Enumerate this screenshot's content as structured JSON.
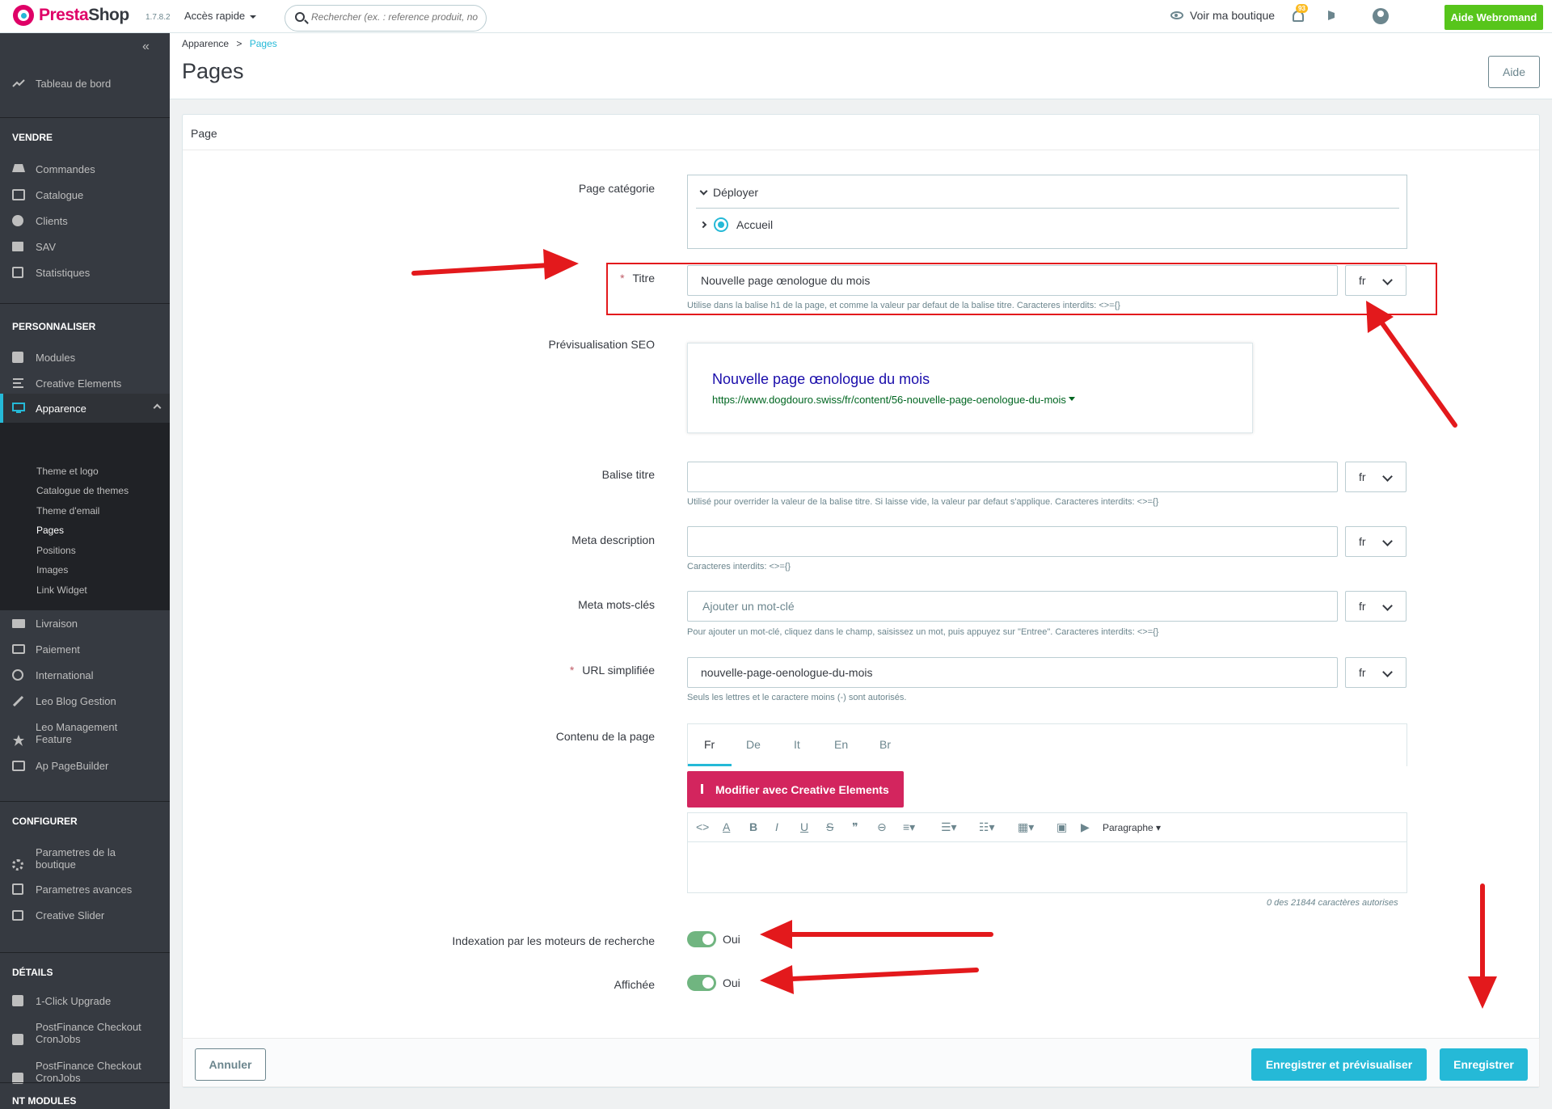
{
  "topbar": {
    "logo_a": "Presta",
    "logo_b": "Shop",
    "version": "1.7.8.2",
    "quick_access": "Accès rapide",
    "search_placeholder": "Rechercher (ex. : reference produit, no",
    "view_shop": "Voir ma boutique",
    "notif_count": "93",
    "help_button": "Aide Webromand"
  },
  "sidebar": {
    "dashboard": "Tableau de bord",
    "sections": {
      "sell": "VENDRE",
      "customize": "PERSONNALISER",
      "configure": "CONFIGURER",
      "details": "DÉTAILS",
      "nt": "NT MODULES"
    },
    "sell_items": [
      "Commandes",
      "Catalogue",
      "Clients",
      "SAV",
      "Statistiques"
    ],
    "customize_items": [
      "Modules",
      "Creative Elements",
      "Apparence"
    ],
    "appearance_sub": [
      "Theme et logo",
      "Catalogue de themes",
      "Theme d'email",
      "Pages",
      "Positions",
      "Images",
      "Link Widget"
    ],
    "more_items": [
      "Livraison",
      "Paiement",
      "International",
      "Leo Blog Gestion",
      "Leo Management",
      "Feature",
      "Ap PageBuilder"
    ],
    "configure_items": [
      "Parametres de la",
      "boutique",
      "Parametres avances",
      "Creative Slider"
    ],
    "details_items": [
      "1-Click Upgrade",
      "PostFinance Checkout",
      "CronJobs",
      "PostFinance Checkout",
      "CronJobs"
    ]
  },
  "header": {
    "crumb_parent": "Apparence",
    "crumb_sep": ">",
    "crumb_current": "Pages",
    "title": "Pages",
    "help": "Aide"
  },
  "form": {
    "panel_title": "Page",
    "category_label": "Page catégorie",
    "deploy": "Déployer",
    "accueil": "Accueil",
    "title_label": "Titre",
    "title_value": "Nouvelle page œnologue du mois",
    "lang": "fr",
    "title_help": "Utilise dans la balise h1 de la page, et comme la valeur par defaut de la balise titre. Caracteres interdits: <>={}",
    "seo_label": "Prévisualisation SEO",
    "seo_title": "Nouvelle page œnologue du mois",
    "seo_url": "https://www.dogdouro.swiss/fr/content/56-nouvelle-page-oenologue-du-mois",
    "meta_title_label": "Balise titre",
    "meta_title_help": "Utilisé pour overrider la valeur de la balise titre. Si laisse vide, la valeur par defaut s'applique. Caracteres interdits: <>={}",
    "meta_desc_label": "Meta description",
    "meta_desc_help": "Caracteres interdits: <>={}",
    "keywords_label": "Meta mots-clés",
    "keywords_placeholder": "Ajouter un mot-clé",
    "keywords_help": "Pour ajouter un mot-clé, cliquez dans le champ, saisissez un mot, puis appuyez sur \"Entree\". Caracteres interdits: <>={}",
    "url_label": "URL simplifiée",
    "url_value": "nouvelle-page-oenologue-du-mois",
    "url_help": "Seuls les lettres et le caractere moins (-) sont autorisés.",
    "content_label": "Contenu de la page",
    "tabs": [
      "Fr",
      "De",
      "It",
      "En",
      "Br"
    ],
    "ce_button": "Modifier avec Creative Elements",
    "paragraph": "Paragraphe",
    "char_count": "0 des 21844 caractères autorises",
    "index_label": "Indexation par les moteurs de recherche",
    "shown_label": "Affichée",
    "yes": "Oui",
    "cancel": "Annuler",
    "save_preview": "Enregistrer et prévisualiser",
    "save": "Enregistrer"
  },
  "colors": {
    "accent": "#25b9d7",
    "brand": "#df0067",
    "ce": "#d3255e",
    "help_green": "#57c51b",
    "switch_on": "#70b580",
    "annotation_red": "#e3191c"
  }
}
